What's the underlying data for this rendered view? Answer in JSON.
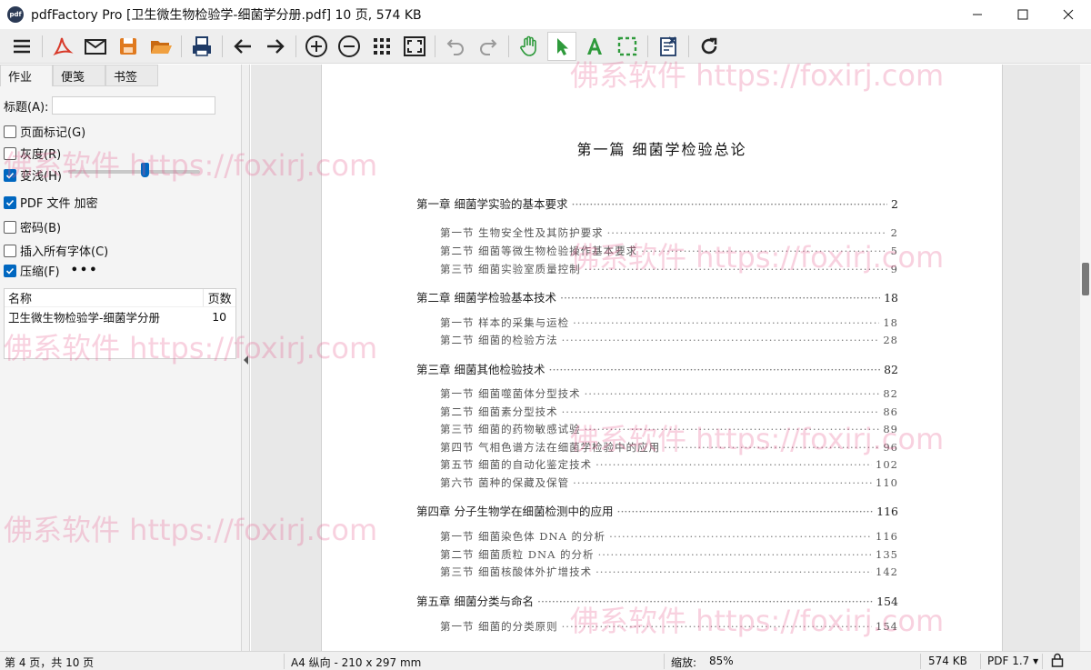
{
  "window": {
    "title": "pdfFactory Pro [卫生微生物检验学-细菌学分册.pdf] 10 页, 574 KB",
    "logo_text": "pdf"
  },
  "left_panel": {
    "tabs": [
      "作业",
      "便笺",
      "书签"
    ],
    "title_label": "标题(A):",
    "title_value": "",
    "options": {
      "page_marks": "页面标记(G)",
      "grayscale": "灰度(R)",
      "lighten": "变浅(H)",
      "pdf_encrypt": "PDF 文件 加密",
      "password": "密码(B)",
      "embed_fonts": "插入所有字体(C)",
      "compress": "压缩(F)"
    },
    "lighten_level_percent": 58,
    "more_label": "•••",
    "file_list": {
      "header_name": "名称",
      "header_pages": "页数",
      "rows": [
        {
          "name": "卫生微生物检验学-细菌学分册",
          "pages": "10"
        }
      ]
    }
  },
  "document": {
    "part_title": "第一篇    细菌学检验总论",
    "toc": [
      {
        "type": "chapter",
        "label": "第一章    细菌学实验的基本要求",
        "page": "2"
      },
      {
        "type": "section",
        "label": "第一节    生物安全性及其防护要求",
        "page": "2"
      },
      {
        "type": "section",
        "label": "第二节    细菌等微生物检验操作基本要求",
        "page": "5"
      },
      {
        "type": "section",
        "label": "第三节    细菌实验室质量控制",
        "page": "9"
      },
      {
        "type": "chapter",
        "label": "第二章    细菌学检验基本技术",
        "page": "18"
      },
      {
        "type": "section",
        "label": "第一节    样本的采集与运检",
        "page": "18"
      },
      {
        "type": "section",
        "label": "第二节    细菌的检验方法",
        "page": "28"
      },
      {
        "type": "chapter",
        "label": "第三章    细菌其他检验技术",
        "page": "82"
      },
      {
        "type": "section",
        "label": "第一节    细菌噬菌体分型技术",
        "page": "82"
      },
      {
        "type": "section",
        "label": "第二节    细菌素分型技术",
        "page": "86"
      },
      {
        "type": "section",
        "label": "第三节    细菌的药物敏感试验",
        "page": "89"
      },
      {
        "type": "section",
        "label": "第四节    气相色谱方法在细菌学检验中的应用",
        "page": "96"
      },
      {
        "type": "section",
        "label": "第五节    细菌的自动化鉴定技术",
        "page": "102"
      },
      {
        "type": "section",
        "label": "第六节    菌种的保藏及保管",
        "page": "110"
      },
      {
        "type": "chapter",
        "label": "第四章    分子生物学在细菌检测中的应用",
        "page": "116"
      },
      {
        "type": "section",
        "label": "第一节    细菌染色体 DNA 的分析",
        "page": "116"
      },
      {
        "type": "section",
        "label": "第二节    细菌质粒 DNA 的分析",
        "page": "135"
      },
      {
        "type": "section",
        "label": "第三节    细菌核酸体外扩增技术",
        "page": "142"
      },
      {
        "type": "chapter",
        "label": "第五章    细菌分类与命名",
        "page": "154"
      },
      {
        "type": "section",
        "label": "第一节    细菌的分类原则",
        "page": "154"
      }
    ]
  },
  "status_bar": {
    "page_info": "第 4 页，共 10 页",
    "paper": "A4 纵向 - 210 x 297 mm",
    "zoom_label": "缩放:",
    "zoom_value": "85%",
    "file_size": "574 KB",
    "pdf_version": "PDF 1.7 ▾"
  },
  "watermark": "佛系软件 https://foxirj.com",
  "colors": {
    "accent": "#0067c0",
    "acrobat_red": "#d83b2b",
    "save_orange": "#e07a1f",
    "green": "#2e9a3b"
  }
}
